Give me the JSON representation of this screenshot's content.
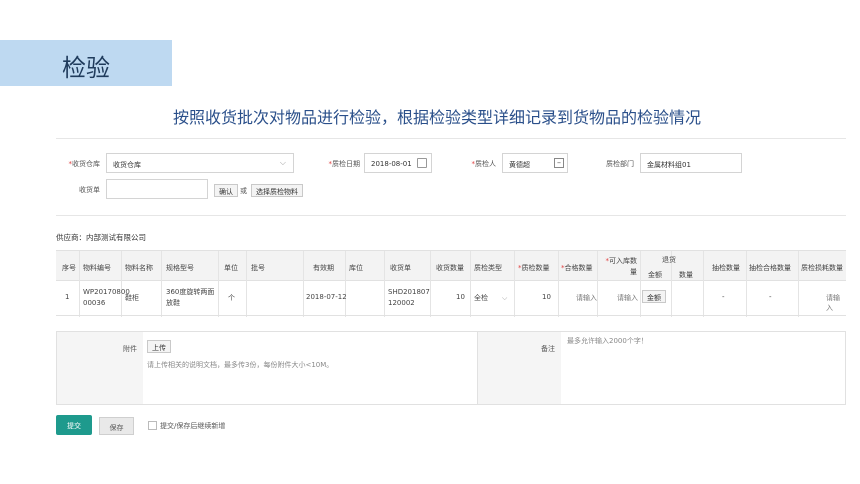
{
  "slide": {
    "title": "检验",
    "subtitle": "按照收货批次对物品进行检验，根据检验类型详细记录到货物品的检验情况"
  },
  "form": {
    "warehouse_label": "收货仓库",
    "warehouse_value": "收货仓库",
    "inspect_date_label": "质检日期",
    "inspect_date_value": "2018-08-01",
    "inspector_label": "质检人",
    "inspector_value": "黄德超",
    "dept_label": "质检部门",
    "dept_value": "金属材料组01",
    "receipt_label": "收货单",
    "confirm_btn": "确认",
    "or_text": "或",
    "select_btn": "选择质检物料"
  },
  "supplier": "供应商：内部测试有限公司",
  "table": {
    "headers": {
      "seq": "序号",
      "code": "物料编号",
      "name": "物料名称",
      "spec": "规格型号",
      "unit": "单位",
      "batch": "批号",
      "expiry": "有效期",
      "location": "库位",
      "receipt": "收货单",
      "recv_qty": "收货数量",
      "insp_type": "质检类型",
      "insp_qty": "质检数量",
      "pass_qty": "合格数量",
      "stock_qty": "可入库数量",
      "return": "退货",
      "return_amount": "金额",
      "return_qty": "数量",
      "sample_qty": "抽检数量",
      "sample_pass": "抽检合格数量",
      "sample_loss": "质检损耗数量"
    },
    "row": {
      "seq": "1",
      "code_l1": "WP20170800",
      "code_l2": "00036",
      "name": "鞋柜",
      "spec_l1": "360度旋转两面",
      "spec_l2": "放鞋",
      "unit": "个",
      "batch": "",
      "expiry": "2018-07-12",
      "location": "",
      "receipt_l1": "SHD201807",
      "receipt_l2": "120002",
      "recv_qty": "10",
      "insp_type": "全检",
      "insp_qty": "10",
      "pass_qty": "请输入",
      "stock_qty": "请输入",
      "return_btn": "金额",
      "sample_qty": "-",
      "sample_pass": "-",
      "sample_loss": "请输入"
    }
  },
  "attachment": {
    "label": "附件",
    "upload_btn": "上传",
    "hint": "请上传相关的说明文档，最多传3份，每份附件大小<10M。",
    "remark_label": "备注",
    "remark_placeholder": "最多允许输入2000个字！"
  },
  "actions": {
    "submit": "提交",
    "save": "保存",
    "continue_label": "提交/保存后继续新增"
  }
}
